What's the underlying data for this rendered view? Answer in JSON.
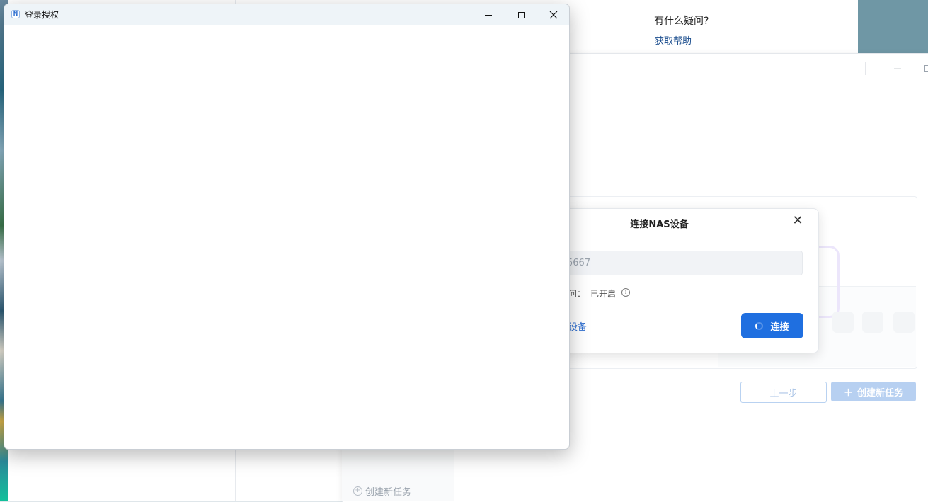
{
  "login_window": {
    "title": "登录授权",
    "app_icon": "app-logo-icon",
    "controls": [
      "minimize-icon",
      "maximize-icon",
      "close-icon"
    ]
  },
  "help_panel": {
    "question": "有什么疑问?",
    "link": "获取帮助"
  },
  "nas_window": {
    "prev_button": "上一步",
    "new_task_button": "创建新任务",
    "sidebar_new_task": "创建新任务"
  },
  "connect_dialog": {
    "title": "连接NAS设备",
    "address_value": "5667",
    "access_label": "问：",
    "access_value": "已开启",
    "other_device_link": "设备",
    "connect_button": "连接"
  },
  "colors": {
    "accent": "#1f6fe0",
    "link": "#1d4f8f",
    "disabled_button": "#b7d0f1"
  }
}
